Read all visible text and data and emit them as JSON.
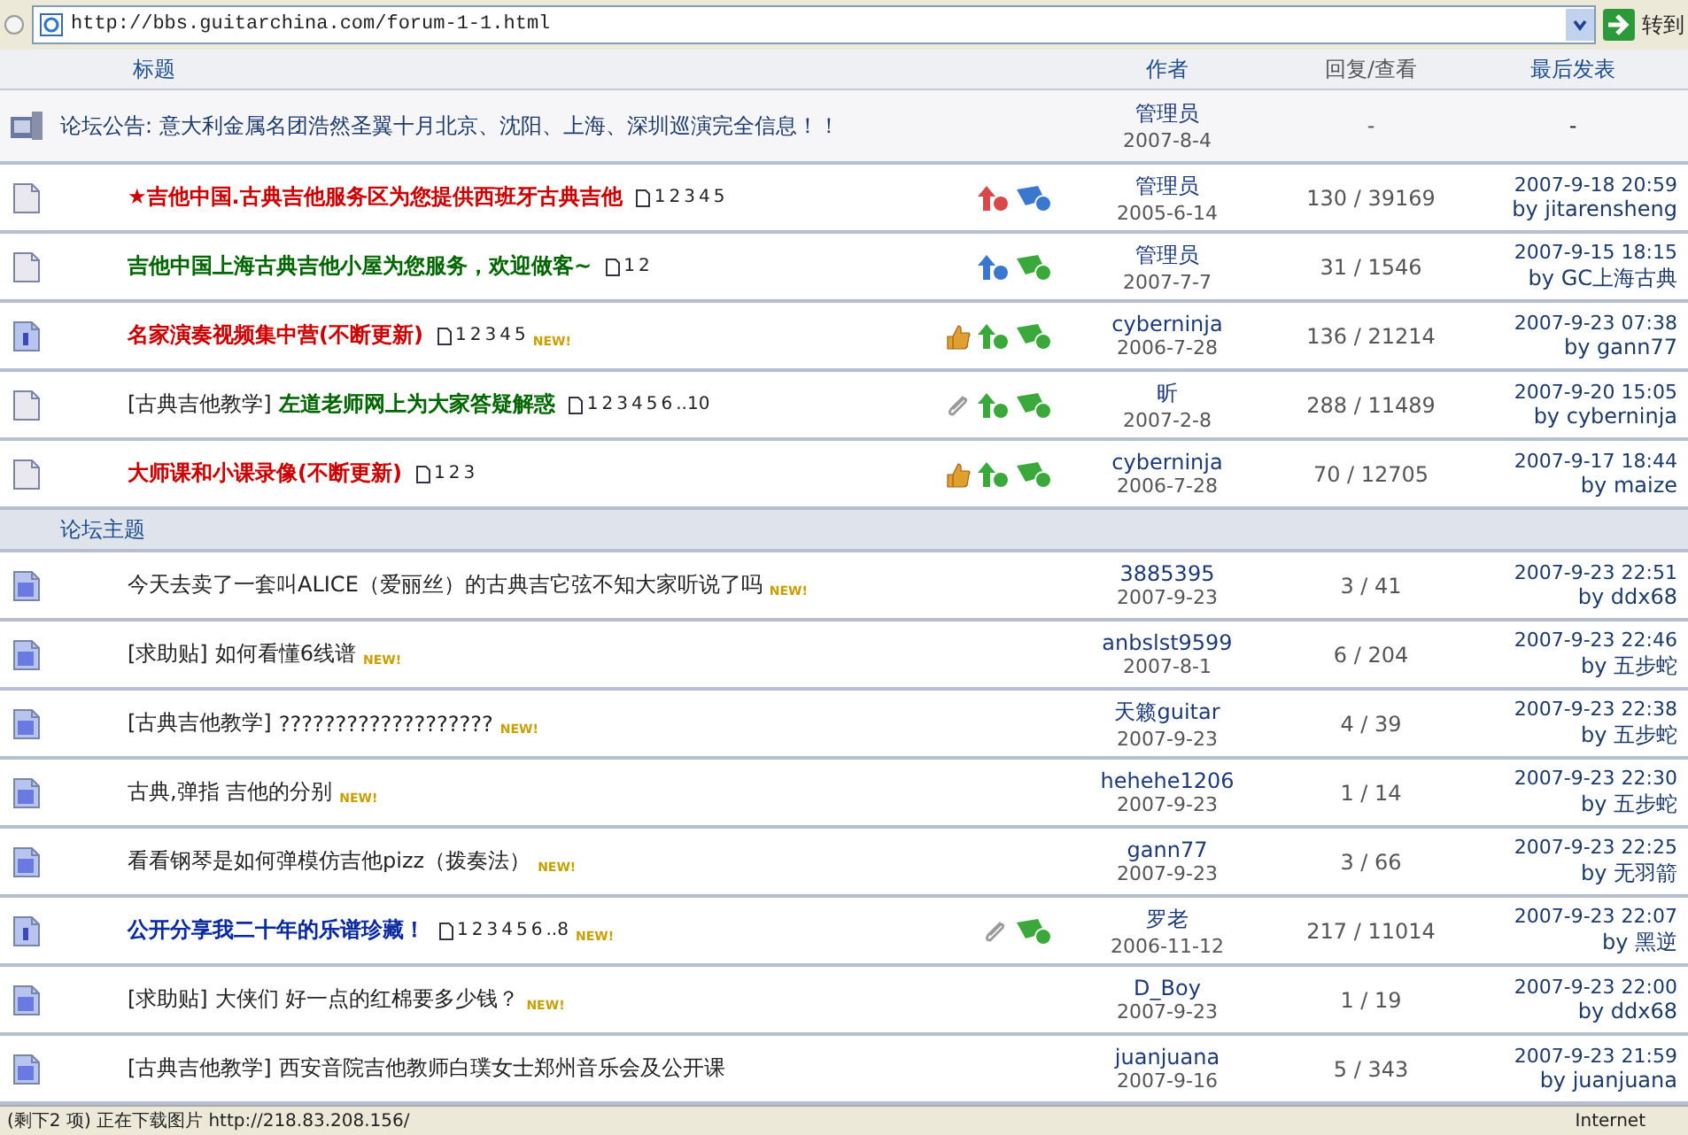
{
  "address_bar": {
    "url": "http://bbs.guitarchina.com/forum-1-1.html",
    "go_label": "转到"
  },
  "columns": [
    "标题",
    "作者",
    "回复/查看",
    "最后发表"
  ],
  "announcement": {
    "label": "论坛公告:",
    "title": "意大利金属名团浩然圣翼十月北京、沈阳、上海、深圳巡演完全信息！！",
    "author": "管理员",
    "date": "2007-8-4",
    "stats": "-",
    "last": "-"
  },
  "sticky_topics": [
    {
      "kind": "sticky",
      "title": "★吉他中国.古典吉他服务区为您提供西班牙古典吉他",
      "color": "#cc0000",
      "bold": true,
      "pages": [
        "1",
        "2",
        "3",
        "4",
        "5"
      ],
      "flags": [
        {
          "kind": "arrow",
          "color": "#d84a4a"
        },
        {
          "kind": "tag",
          "color": "#3a78d0"
        }
      ],
      "author": "管理员",
      "date": "2005-6-14",
      "stats": "130 / 39169",
      "last_time": "2007-9-18 20:59",
      "last_by": "by jitarensheng"
    },
    {
      "kind": "sticky",
      "title": "吉他中国上海古典吉他小屋为您服务，欢迎做客~",
      "color": "#006600",
      "bold": true,
      "pages": [
        "1",
        "2"
      ],
      "flags": [
        {
          "kind": "arrow",
          "color": "#3a78d0"
        },
        {
          "kind": "tag",
          "color": "#3aa83a"
        }
      ],
      "author": "管理员",
      "date": "2007-7-7",
      "stats": "31 / 1546",
      "last_time": "2007-9-15 18:15",
      "last_by": "by GC上海古典"
    },
    {
      "kind": "info",
      "title": "名家演奏视频集中营(不断更新)",
      "color": "#cc0000",
      "bold": true,
      "pages": [
        "1",
        "2",
        "3",
        "4",
        "5"
      ],
      "new_badge": "NEW!",
      "flags": [
        {
          "kind": "thumb",
          "color": "#e0a030"
        },
        {
          "kind": "arrow",
          "color": "#3aa83a"
        },
        {
          "kind": "tag",
          "color": "#3aa83a"
        }
      ],
      "author": "cyberninja",
      "date": "2006-7-28",
      "stats": "136 / 21214",
      "last_time": "2007-9-23 07:38",
      "last_by": "by gann77"
    },
    {
      "kind": "sticky",
      "prefix": "[古典吉他教学]",
      "title": "左道老师网上为大家答疑解惑",
      "color": "#006600",
      "bold": true,
      "pages": [
        "1",
        "2",
        "3",
        "4",
        "5",
        "6",
        "..10"
      ],
      "flags": [
        {
          "kind": "clip",
          "color": "#9a9a9a"
        },
        {
          "kind": "arrow",
          "color": "#3aa83a"
        },
        {
          "kind": "tag",
          "color": "#3aa83a"
        }
      ],
      "author": "昕",
      "date": "2007-2-8",
      "stats": "288 / 11489",
      "last_time": "2007-9-20 15:05",
      "last_by": "by cyberninja"
    },
    {
      "kind": "sticky",
      "title": "大师课和小课录像(不断更新)",
      "color": "#cc0000",
      "bold": true,
      "pages": [
        "1",
        "2",
        "3"
      ],
      "flags": [
        {
          "kind": "thumb",
          "color": "#e0a030"
        },
        {
          "kind": "arrow",
          "color": "#3aa83a"
        },
        {
          "kind": "tag",
          "color": "#3aa83a"
        }
      ],
      "author": "cyberninja",
      "date": "2006-7-28",
      "stats": "70 / 12705",
      "last_time": "2007-9-17 18:44",
      "last_by": "by maize"
    }
  ],
  "section_title": "论坛主题",
  "topics": [
    {
      "kind": "normal",
      "title": "今天去卖了一套叫ALICE（爱丽丝）的古典吉它弦不知大家听说了吗",
      "color": "#222222",
      "bold": false,
      "new_badge": "NEW!",
      "author": "3885395",
      "date": "2007-9-23",
      "stats": "3 / 41",
      "last_time": "2007-9-23 22:51",
      "last_by": "by ddx68"
    },
    {
      "kind": "normal",
      "prefix": "[求助贴]",
      "title": "如何看懂6线谱",
      "color": "#222222",
      "bold": false,
      "new_badge": "NEW!",
      "author": "anbslst9599",
      "date": "2007-8-1",
      "stats": "6 / 204",
      "last_time": "2007-9-23 22:46",
      "last_by": "by 五步蛇"
    },
    {
      "kind": "normal",
      "prefix": "[古典吉他教学]",
      "title": "???????????????????",
      "color": "#222222",
      "bold": false,
      "new_badge": "NEW!",
      "author": "天籁guitar",
      "date": "2007-9-23",
      "stats": "4 / 39",
      "last_time": "2007-9-23 22:38",
      "last_by": "by 五步蛇"
    },
    {
      "kind": "normal",
      "title": "古典,弹指 吉他的分别",
      "color": "#222222",
      "bold": false,
      "new_badge": "NEW!",
      "author": "hehehe1206",
      "date": "2007-9-23",
      "stats": "1 / 14",
      "last_time": "2007-9-23 22:30",
      "last_by": "by 五步蛇"
    },
    {
      "kind": "normal",
      "title": "看看钢琴是如何弹模仿吉他pizz（拨奏法）",
      "color": "#222222",
      "bold": false,
      "new_badge": "NEW!",
      "author": "gann77",
      "date": "2007-9-23",
      "stats": "3 / 66",
      "last_time": "2007-9-23 22:25",
      "last_by": "by 无羽箭"
    },
    {
      "kind": "info",
      "title": "公开分享我二十年的乐谱珍藏！",
      "color": "#0a2aa0",
      "bold": true,
      "pages": [
        "1",
        "2",
        "3",
        "4",
        "5",
        "6",
        "..8"
      ],
      "new_badge": "NEW!",
      "flags": [
        {
          "kind": "clip",
          "color": "#9a9a9a"
        },
        {
          "kind": "tag",
          "color": "#3aa83a"
        }
      ],
      "author": "罗老",
      "date": "2006-11-12",
      "stats": "217 / 11014",
      "last_time": "2007-9-23 22:07",
      "last_by": "by 黑逆"
    },
    {
      "kind": "normal",
      "prefix": "[求助贴]",
      "title": "大侠们 好一点的红棉要多少钱？",
      "color": "#222222",
      "bold": false,
      "new_badge": "NEW!",
      "author": "D_Boy",
      "date": "2007-9-23",
      "stats": "1 / 19",
      "last_time": "2007-9-23 22:00",
      "last_by": "by ddx68"
    },
    {
      "kind": "normal",
      "prefix": "[古典吉他教学]",
      "title": "西安音院吉他教师白璞女士郑州音乐会及公开课",
      "color": "#222222",
      "bold": false,
      "author": "juanjuana",
      "date": "2007-9-16",
      "stats": "5 / 343",
      "last_time": "2007-9-23 21:59",
      "last_by": "by juanjuana"
    }
  ],
  "status_bar": {
    "text": "(剩下2 项) 正在下载图片 http://218.83.208.156/",
    "zone": "Internet"
  }
}
